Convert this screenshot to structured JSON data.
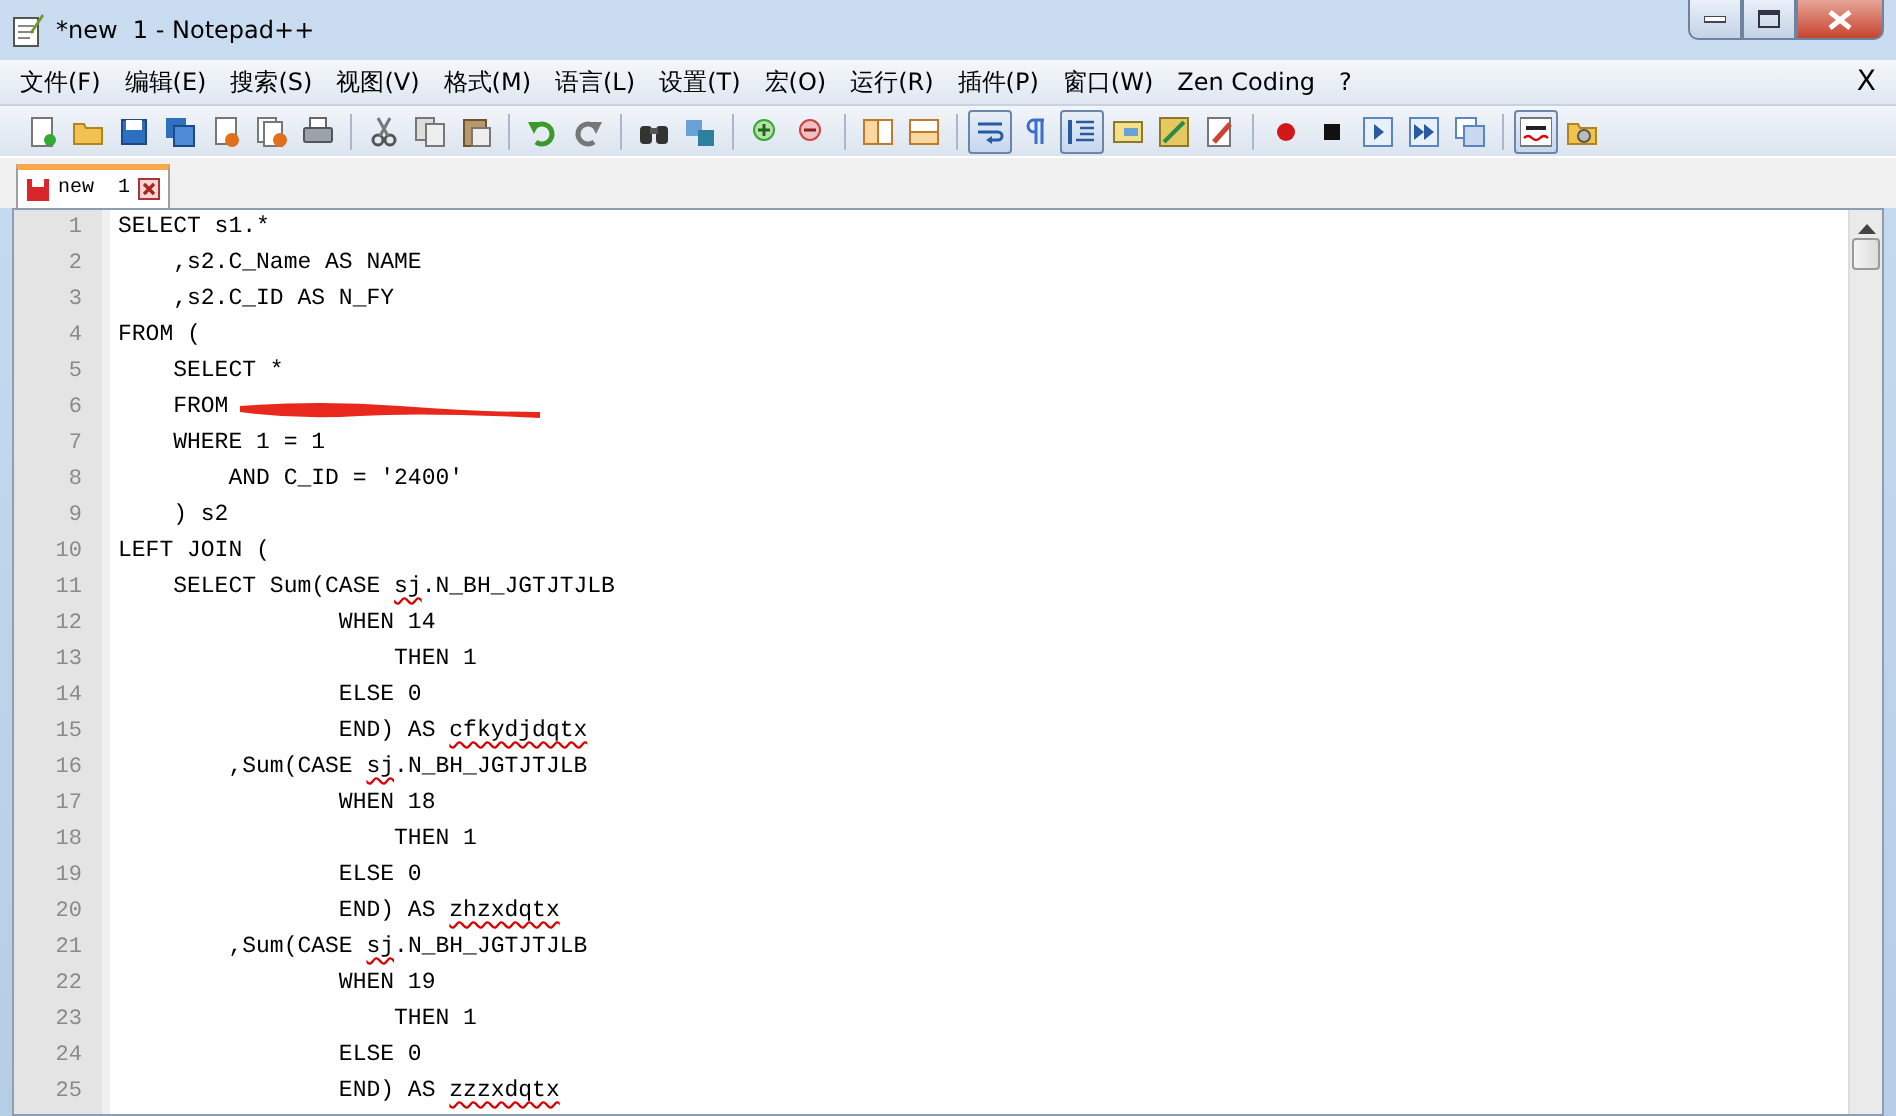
{
  "window": {
    "title": "*new  1 - Notepad++"
  },
  "menu": {
    "items": [
      "文件(F)",
      "编辑(E)",
      "搜索(S)",
      "视图(V)",
      "格式(M)",
      "语言(L)",
      "设置(T)",
      "宏(O)",
      "运行(R)",
      "插件(P)",
      "窗口(W)",
      "Zen Coding",
      "?"
    ],
    "close_label": "X"
  },
  "toolbar": [
    {
      "kind": "button",
      "pressed": false
    },
    {
      "kind": "button",
      "pressed": false
    },
    {
      "kind": "button",
      "pressed": false
    },
    {
      "kind": "button",
      "pressed": false
    },
    {
      "kind": "button",
      "pressed": false
    },
    {
      "kind": "button",
      "pressed": false
    },
    {
      "kind": "button",
      "pressed": false
    },
    {
      "kind": "separator"
    },
    {
      "kind": "button",
      "pressed": false
    },
    {
      "kind": "button",
      "pressed": false
    },
    {
      "kind": "button",
      "pressed": false
    },
    {
      "kind": "separator"
    },
    {
      "kind": "button",
      "pressed": false
    },
    {
      "kind": "button",
      "pressed": false
    },
    {
      "kind": "separator"
    },
    {
      "kind": "button",
      "pressed": false
    },
    {
      "kind": "button",
      "pressed": false
    },
    {
      "kind": "separator"
    },
    {
      "kind": "button",
      "pressed": false
    },
    {
      "kind": "button",
      "pressed": false
    },
    {
      "kind": "separator"
    },
    {
      "kind": "button",
      "pressed": false
    },
    {
      "kind": "button",
      "pressed": false
    },
    {
      "kind": "separator"
    },
    {
      "kind": "button",
      "pressed": true
    },
    {
      "kind": "button",
      "pressed": false
    },
    {
      "kind": "button",
      "pressed": true
    },
    {
      "kind": "button",
      "pressed": false
    },
    {
      "kind": "button",
      "pressed": false
    },
    {
      "kind": "button",
      "pressed": false
    },
    {
      "kind": "separator"
    },
    {
      "kind": "button",
      "pressed": false
    },
    {
      "kind": "button",
      "pressed": false
    },
    {
      "kind": "button",
      "pressed": false
    },
    {
      "kind": "button",
      "pressed": false
    },
    {
      "kind": "button",
      "pressed": false
    },
    {
      "kind": "separator"
    },
    {
      "kind": "button",
      "pressed": true
    },
    {
      "kind": "button",
      "pressed": false
    }
  ],
  "tabs": [
    {
      "label": "new  1",
      "selected": true,
      "modified": true
    }
  ],
  "editor": {
    "lines": [
      {
        "number": "1",
        "segments": [
          {
            "text": "SELECT s1.*"
          }
        ]
      },
      {
        "number": "2",
        "segments": [
          {
            "text": "    ,s2.C_Name AS NAME"
          }
        ]
      },
      {
        "number": "3",
        "segments": [
          {
            "text": "    ,s2.C_ID AS N_FY"
          }
        ]
      },
      {
        "number": "4",
        "segments": [
          {
            "text": "FROM ("
          }
        ]
      },
      {
        "number": "5",
        "segments": [
          {
            "text": "    SELECT *"
          }
        ]
      },
      {
        "number": "6",
        "segments": [
          {
            "text": "    FROM"
          }
        ],
        "redacted": true
      },
      {
        "number": "7",
        "segments": [
          {
            "text": "    WHERE 1 = 1"
          }
        ]
      },
      {
        "number": "8",
        "segments": [
          {
            "text": "        AND C_ID = '2400'"
          }
        ]
      },
      {
        "number": "9",
        "segments": [
          {
            "text": "    ) s2"
          }
        ]
      },
      {
        "number": "10",
        "segments": [
          {
            "text": "LEFT JOIN ("
          }
        ]
      },
      {
        "number": "11",
        "segments": [
          {
            "text": "    SELECT Sum(CASE "
          },
          {
            "text": "sj",
            "misspelled": true
          },
          {
            "text": ".N_BH_JGTJTJLB"
          }
        ]
      },
      {
        "number": "12",
        "segments": [
          {
            "text": "                WHEN 14"
          }
        ]
      },
      {
        "number": "13",
        "segments": [
          {
            "text": "                    THEN 1"
          }
        ]
      },
      {
        "number": "14",
        "segments": [
          {
            "text": "                ELSE 0"
          }
        ]
      },
      {
        "number": "15",
        "segments": [
          {
            "text": "                END) AS "
          },
          {
            "text": "cfkydjdqtx",
            "misspelled": true
          }
        ]
      },
      {
        "number": "16",
        "segments": [
          {
            "text": "        ,Sum(CASE "
          },
          {
            "text": "sj",
            "misspelled": true
          },
          {
            "text": ".N_BH_JGTJTJLB"
          }
        ]
      },
      {
        "number": "17",
        "segments": [
          {
            "text": "                WHEN 18"
          }
        ]
      },
      {
        "number": "18",
        "segments": [
          {
            "text": "                    THEN 1"
          }
        ]
      },
      {
        "number": "19",
        "segments": [
          {
            "text": "                ELSE 0"
          }
        ]
      },
      {
        "number": "20",
        "segments": [
          {
            "text": "                END) AS "
          },
          {
            "text": "zhzxdqtx",
            "misspelled": true
          }
        ]
      },
      {
        "number": "21",
        "segments": [
          {
            "text": "        ,Sum(CASE "
          },
          {
            "text": "sj",
            "misspelled": true
          },
          {
            "text": ".N_BH_JGTJTJLB"
          }
        ]
      },
      {
        "number": "22",
        "segments": [
          {
            "text": "                WHEN 19"
          }
        ]
      },
      {
        "number": "23",
        "segments": [
          {
            "text": "                    THEN 1"
          }
        ]
      },
      {
        "number": "24",
        "segments": [
          {
            "text": "                ELSE 0"
          }
        ]
      },
      {
        "number": "25",
        "segments": [
          {
            "text": "                END) AS "
          },
          {
            "text": "zzzxdqtx",
            "misspelled": true
          }
        ]
      }
    ]
  }
}
